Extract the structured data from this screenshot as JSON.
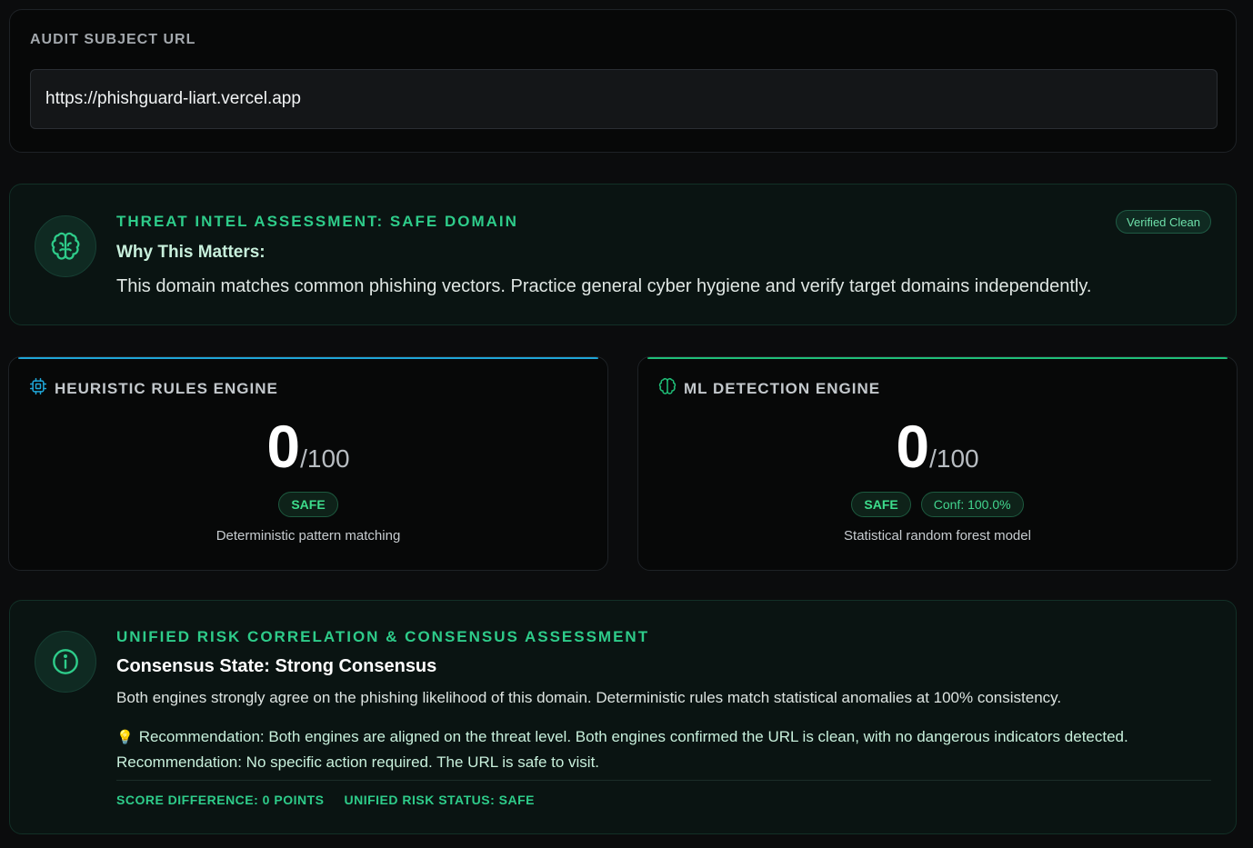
{
  "url_section": {
    "label": "AUDIT SUBJECT URL",
    "value": "https://phishguard-liart.vercel.app"
  },
  "threat_intel": {
    "icon": "brain-icon",
    "title": "THREAT INTEL ASSESSMENT: SAFE DOMAIN",
    "badge": "Verified Clean",
    "heading": "Why This Matters:",
    "text": "This domain matches common phishing vectors. Practice general cyber hygiene and verify target domains independently."
  },
  "heuristic_engine": {
    "icon": "cpu-chip-icon",
    "title": "HEURISTIC RULES ENGINE",
    "score": "0",
    "score_max": "/100",
    "status": "SAFE",
    "description": "Deterministic pattern matching",
    "accent": "#1fa6d8"
  },
  "ml_engine": {
    "icon": "brain-icon",
    "title": "ML DETECTION ENGINE",
    "score": "0",
    "score_max": "/100",
    "status": "SAFE",
    "confidence": "Conf: 100.0%",
    "description": "Statistical random forest model",
    "accent": "#1fbf78"
  },
  "consensus": {
    "icon": "info-icon",
    "title": "UNIFIED RISK CORRELATION & CONSENSUS ASSESSMENT",
    "state": "Consensus State: Strong Consensus",
    "text": "Both engines strongly agree on the phishing likelihood of this domain. Deterministic rules match statistical anomalies at 100% consistency.",
    "recommendation": "Recommendation: Both engines are aligned on the threat level. Both engines confirmed the URL is clean, with no dangerous indicators detected. Recommendation: No specific action required. The URL is safe to visit.",
    "score_difference": "SCORE DIFFERENCE: 0 POINTS",
    "unified_status": "UNIFIED RISK STATUS: SAFE"
  },
  "colors": {
    "success": "#2ecc8a",
    "background": "#0b0c0d"
  }
}
